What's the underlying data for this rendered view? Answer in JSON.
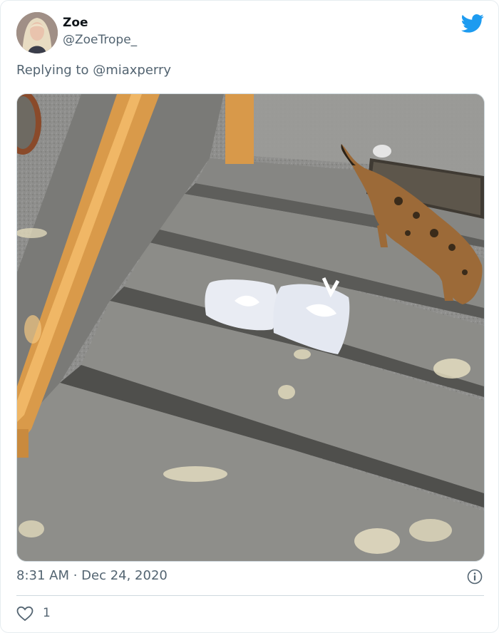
{
  "tweet": {
    "author_name": "Zoe",
    "author_handle": "@ZoeTrope_",
    "replying_prefix": "Replying to",
    "replying_to": "@miaxperry",
    "timestamp": "8:31 AM · Dec 24, 2020",
    "like_count": "1"
  },
  "icons": {
    "brand": "twitter-bird-icon",
    "info": "info-icon",
    "like": "heart-icon"
  },
  "colors": {
    "brand_blue": "#1d9bf0",
    "secondary_text": "#536471",
    "divider": "#cfd9de"
  }
}
